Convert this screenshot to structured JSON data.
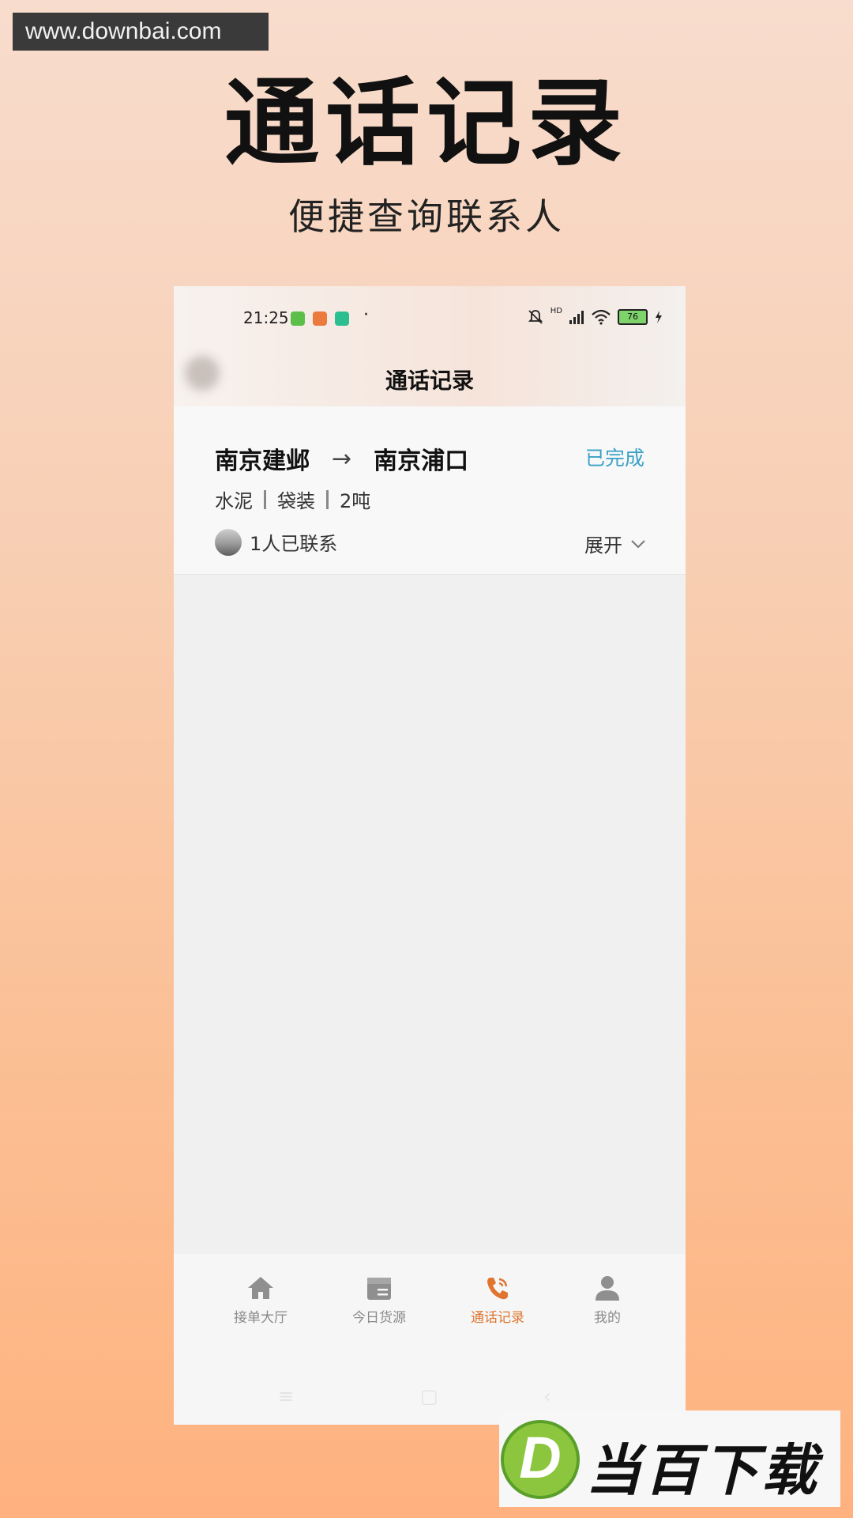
{
  "watermark": "www.downbai.com",
  "promo": {
    "title": "通话记录",
    "subtitle": "便捷查询联系人"
  },
  "status_bar": {
    "time": "21:25",
    "dot": "·",
    "network": "HD",
    "battery": "76",
    "icons": [
      "mute-bell-icon",
      "signal-icon",
      "wifi-icon",
      "battery-icon",
      "charging-icon"
    ]
  },
  "page": {
    "title": "通话记录"
  },
  "record": {
    "from": "南京建邺",
    "arrow": "→",
    "to": "南京浦口",
    "status": "已完成",
    "tags": [
      "水泥",
      "袋装",
      "2吨"
    ],
    "contacts": "1人已联系",
    "expand": "展开"
  },
  "tabs": [
    {
      "label": "接单大厅",
      "icon": "home-icon",
      "active": false
    },
    {
      "label": "今日货源",
      "icon": "cargo-box-icon",
      "active": false
    },
    {
      "label": "通话记录",
      "icon": "phone-icon",
      "active": true
    },
    {
      "label": "我的",
      "icon": "user-icon",
      "active": false
    }
  ],
  "system_nav": [
    "≡",
    "▢",
    "‹"
  ],
  "logo": {
    "letter": "D",
    "text": "当百下载"
  },
  "colors": {
    "accent_orange": "#e0752f",
    "status_blue": "#3aa2c7",
    "tab_inactive": "#8a8a8a"
  }
}
